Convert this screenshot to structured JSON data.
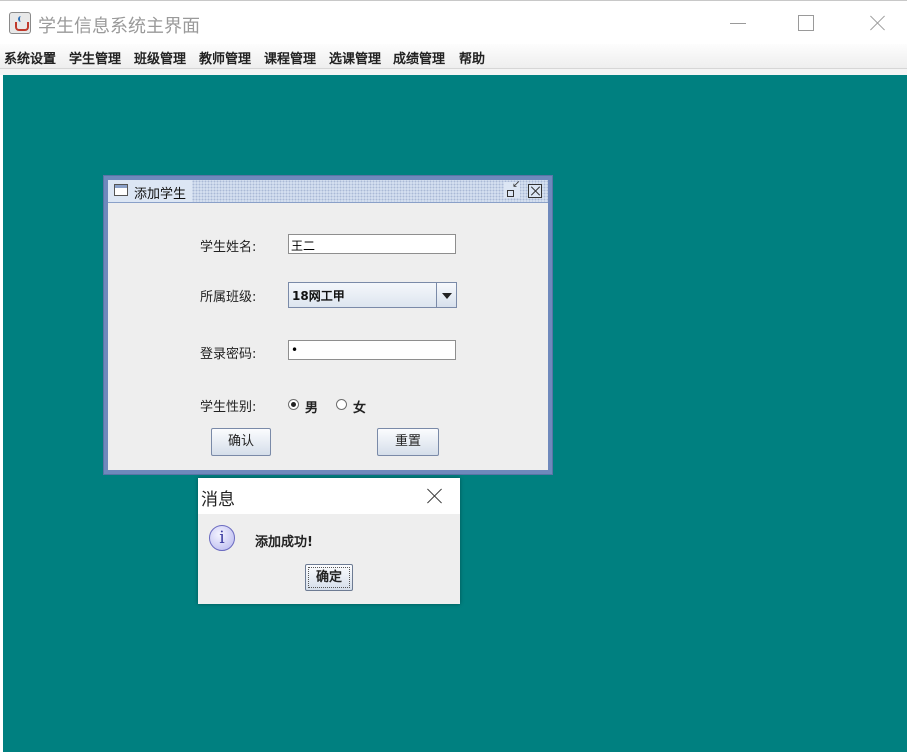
{
  "window": {
    "title": "学生信息系统主界面"
  },
  "menu": {
    "items": [
      {
        "label": "系统设置"
      },
      {
        "label": "学生管理"
      },
      {
        "label": "班级管理"
      },
      {
        "label": "教师管理"
      },
      {
        "label": "课程管理"
      },
      {
        "label": "选课管理"
      },
      {
        "label": "成绩管理"
      },
      {
        "label": "帮助"
      }
    ]
  },
  "desktop": {
    "background_color": "#008080"
  },
  "add_student_frame": {
    "title": "添加学生",
    "name_label": "学生姓名:",
    "name_value": "王二",
    "class_label": "所属班级:",
    "class_selected": "18网工甲",
    "password_label": "登录密码:",
    "password_value": "•",
    "gender_label": "学生性别:",
    "gender_options": [
      {
        "label": "男",
        "checked": true
      },
      {
        "label": "女",
        "checked": false
      }
    ],
    "confirm_label": "确认",
    "reset_label": "重置"
  },
  "message_dialog": {
    "title": "消息",
    "icon": "info-icon",
    "icon_glyph": "i",
    "message": "添加成功!",
    "ok_label": "确定"
  }
}
